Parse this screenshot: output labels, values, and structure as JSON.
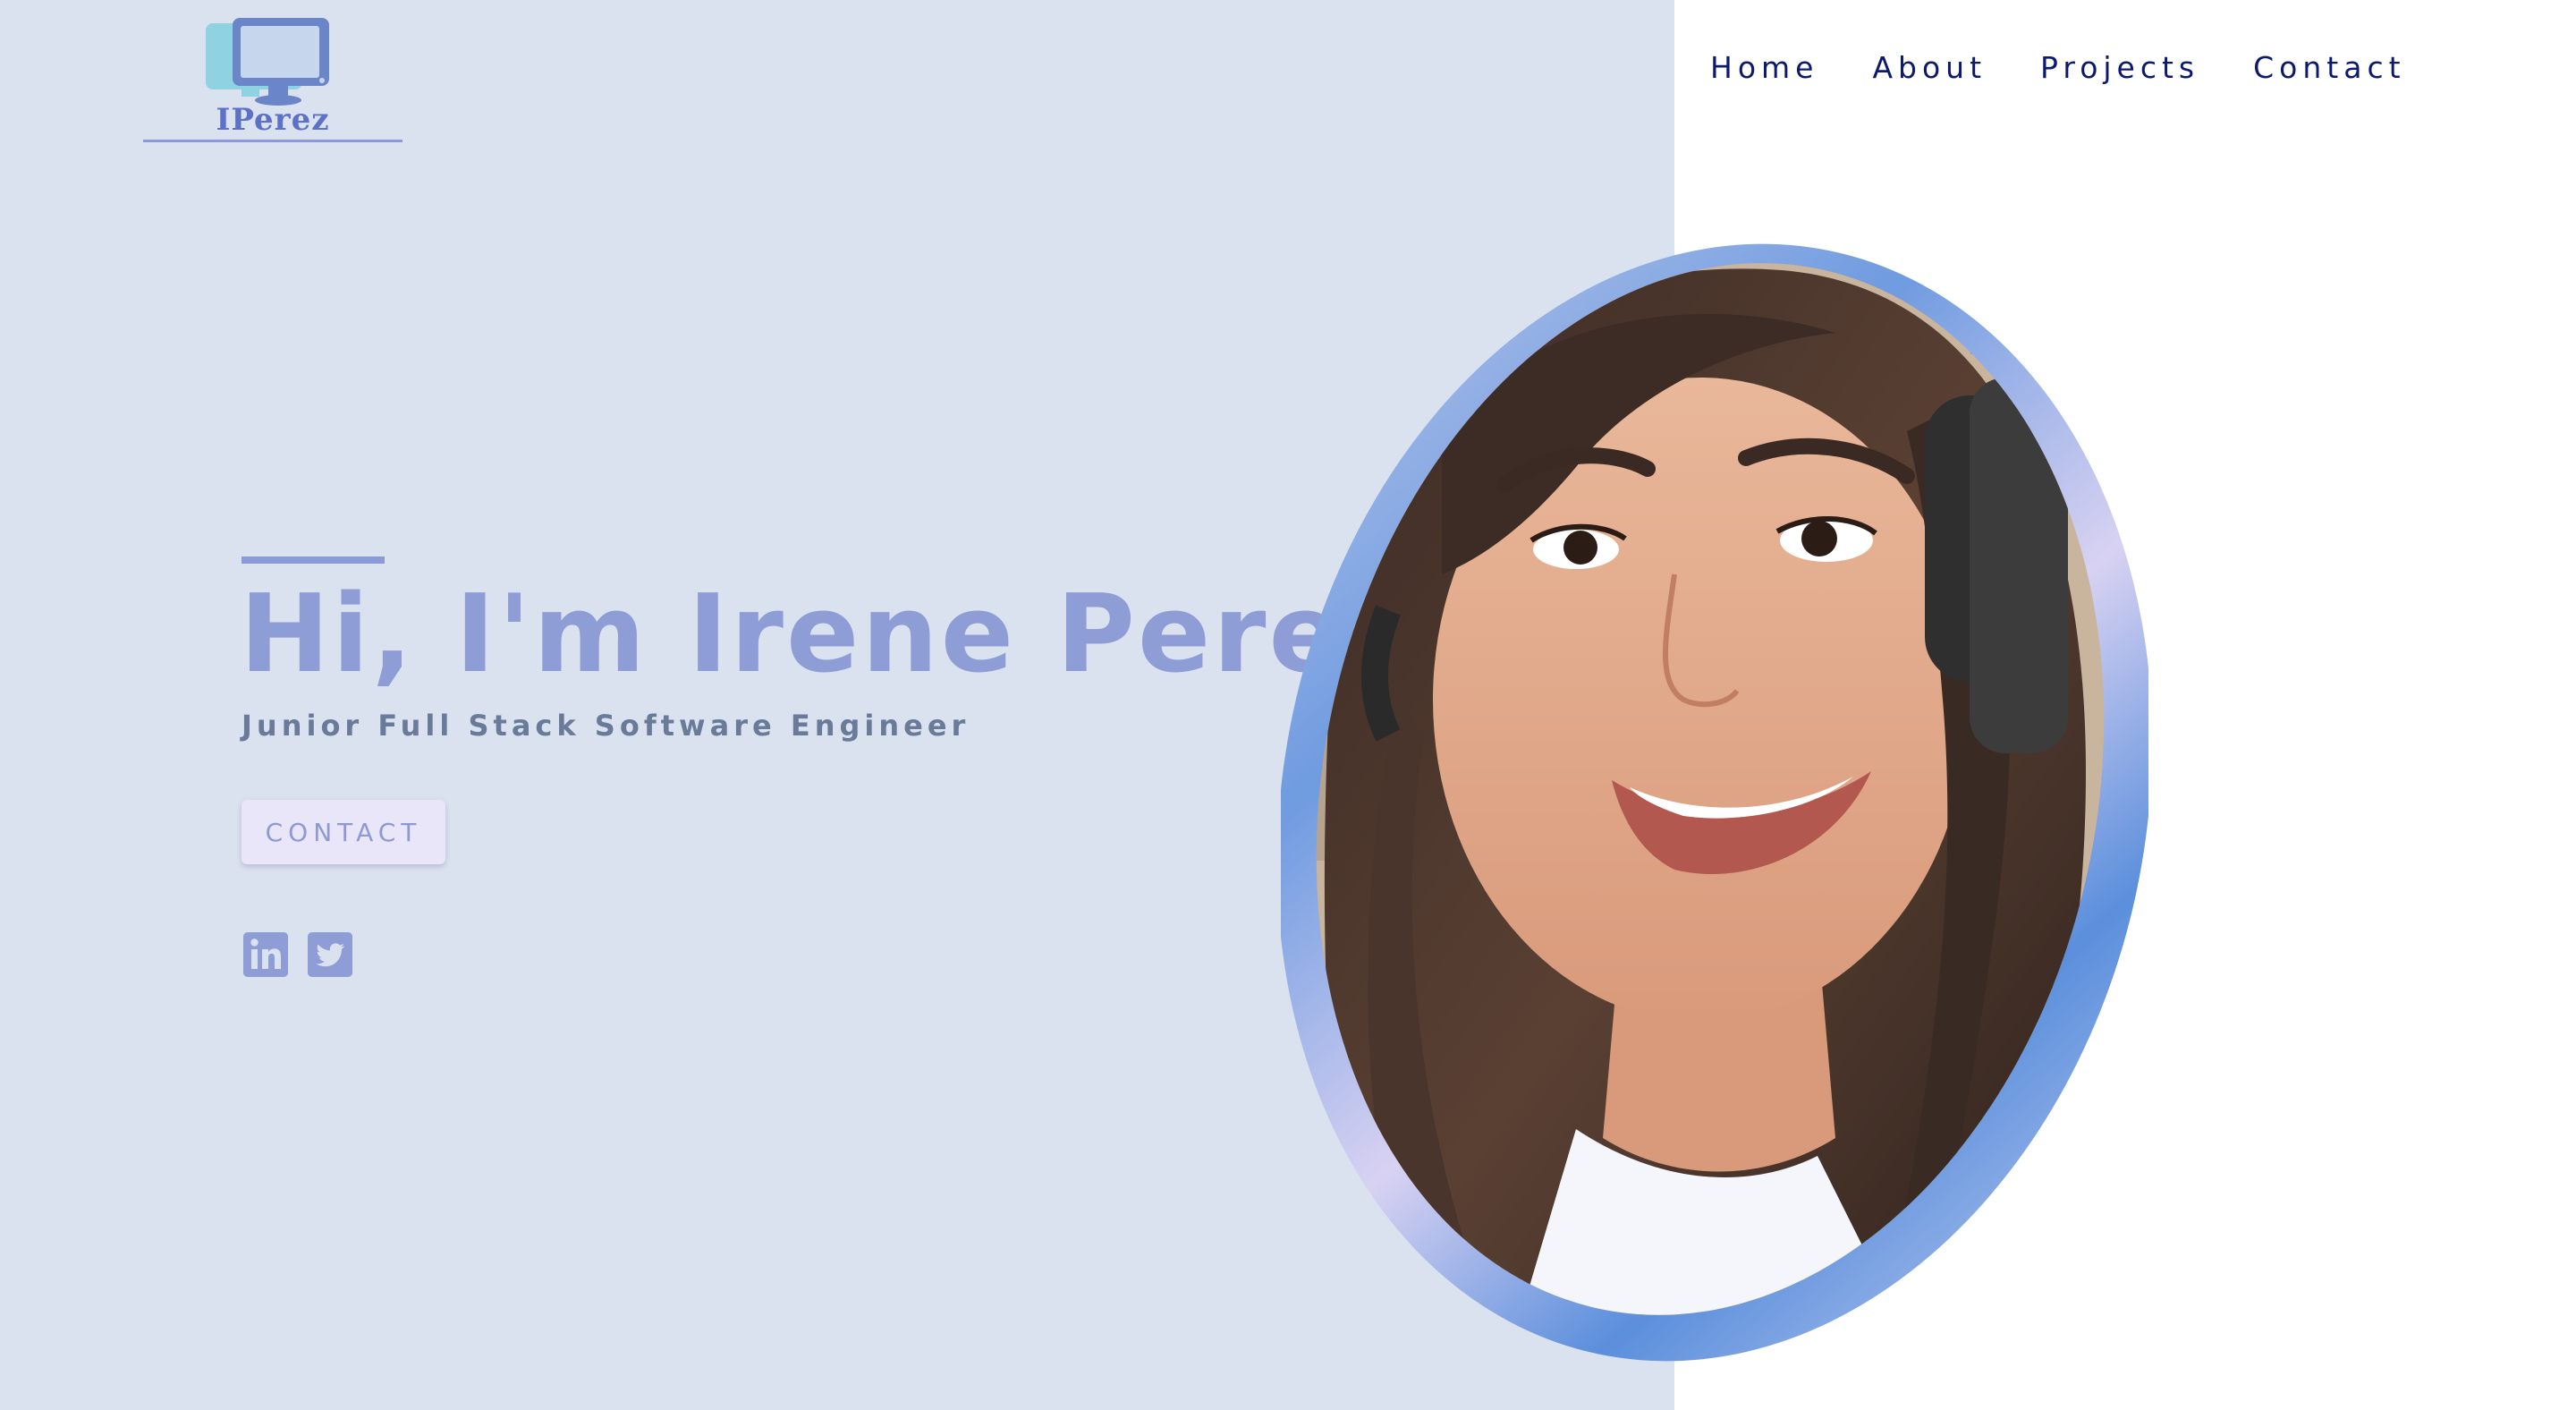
{
  "logo": {
    "text": "IPerez",
    "icon": "monitor-icon"
  },
  "nav": {
    "items": [
      {
        "label": "Home"
      },
      {
        "label": "About"
      },
      {
        "label": "Projects"
      },
      {
        "label": "Contact"
      }
    ]
  },
  "hero": {
    "title": "Hi, I'm Irene Perez",
    "subtitle": "Junior Full Stack Software Engineer",
    "contact_button": "CONTACT"
  },
  "social": [
    {
      "icon": "linkedin-icon"
    },
    {
      "icon": "twitter-icon"
    }
  ],
  "colors": {
    "left_background": "#dae1ef",
    "right_background": "#ffffff",
    "accent": "#8e9dd6",
    "nav_text": "#0b1a6e",
    "subtitle_text": "#6a7b9a",
    "button_background": "#e8e6f8"
  }
}
